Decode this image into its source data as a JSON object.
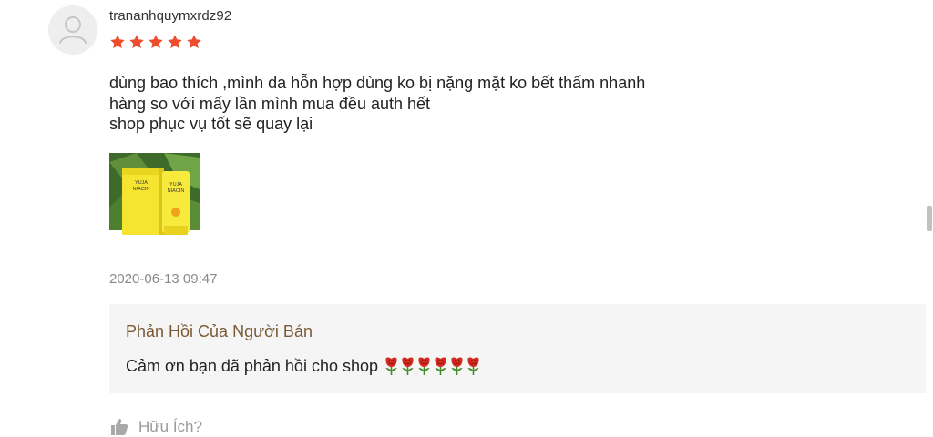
{
  "review": {
    "username": "trananhquymxrdz92",
    "rating": 5,
    "rating_max": 5,
    "comment_lines": [
      "dùng bao thích ,mình da hỗn hợp dùng ko bị nặng mặt ko bết thấm nhanh",
      "hàng so với mấy lần mình mua đều auth hết",
      "shop phục vụ tốt sẽ quay lại"
    ],
    "image_text": [
      "YUJA",
      "NIACIN"
    ],
    "timestamp": "2020-06-13 09:47"
  },
  "seller_reply": {
    "title": "Phản Hồi Của Người Bán",
    "text": "Cảm ơn bạn đã phản hồi cho shop",
    "rose_count": 6
  },
  "helpful": {
    "label": "Hữu Ích?",
    "icon": "thumbs-up-icon"
  },
  "colors": {
    "star": "#ee4d2d",
    "reply_title": "#7a5a35",
    "reply_bg": "#f5f5f5",
    "timestamp": "#8a8a8a"
  }
}
